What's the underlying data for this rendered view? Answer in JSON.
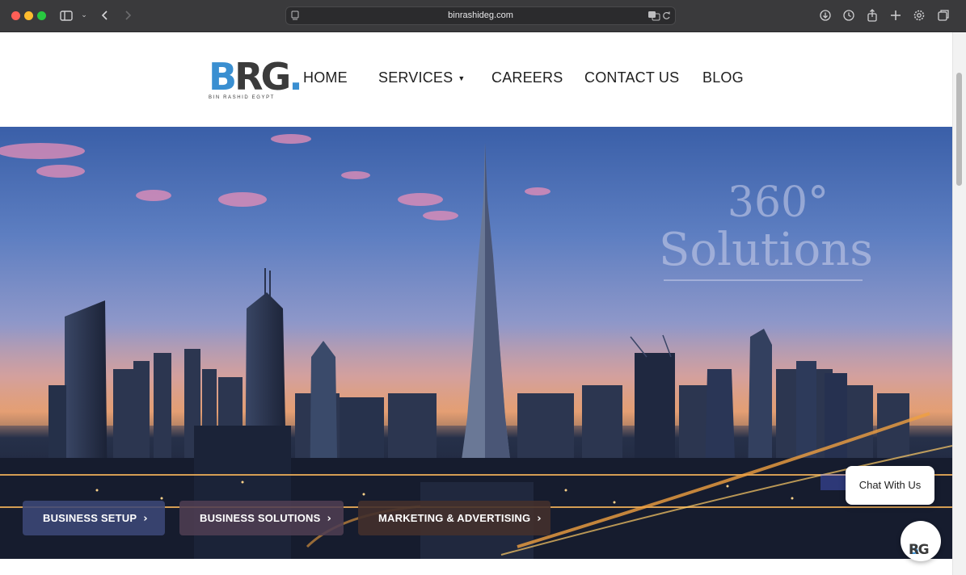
{
  "browser": {
    "url": "binrashideg.com",
    "traffic_lights": [
      "close",
      "minimize",
      "zoom"
    ],
    "toolbar_icons": [
      "sidebar-icon",
      "chevron-down-icon",
      "back-icon",
      "forward-icon",
      "download-icon",
      "history-icon",
      "share-icon",
      "new-tab-icon",
      "settings-icon",
      "tabs-icon"
    ]
  },
  "header": {
    "logo": {
      "letters_b": "B",
      "letters_rg": "RG",
      "dot": ".",
      "tagline": "BIN RASHID EGYPT"
    },
    "nav": [
      {
        "label": "HOME"
      },
      {
        "label": "SERVICES",
        "caret": "▼"
      },
      {
        "label": "CAREERS"
      },
      {
        "label": "CONTACT US"
      },
      {
        "label": "BLOG"
      }
    ]
  },
  "hero": {
    "slogan_top": "360°",
    "slogan_bottom": "Solutions",
    "buttons": [
      {
        "label": "BUSINESS SETUP",
        "chevron": "›"
      },
      {
        "label": "BUSINESS SOLUTIONS",
        "chevron": "›"
      },
      {
        "label": "MARKETING & ADVERTISING",
        "chevron": "›"
      }
    ]
  },
  "chat": {
    "bubble_text": "Chat With Us",
    "avatar_letters_b": "B",
    "avatar_letters_rg": "RG"
  },
  "colors": {
    "brand_blue": "#3a8fd1",
    "brand_dark": "#3b3b3b",
    "chrome_bg": "#3a3a3c"
  }
}
